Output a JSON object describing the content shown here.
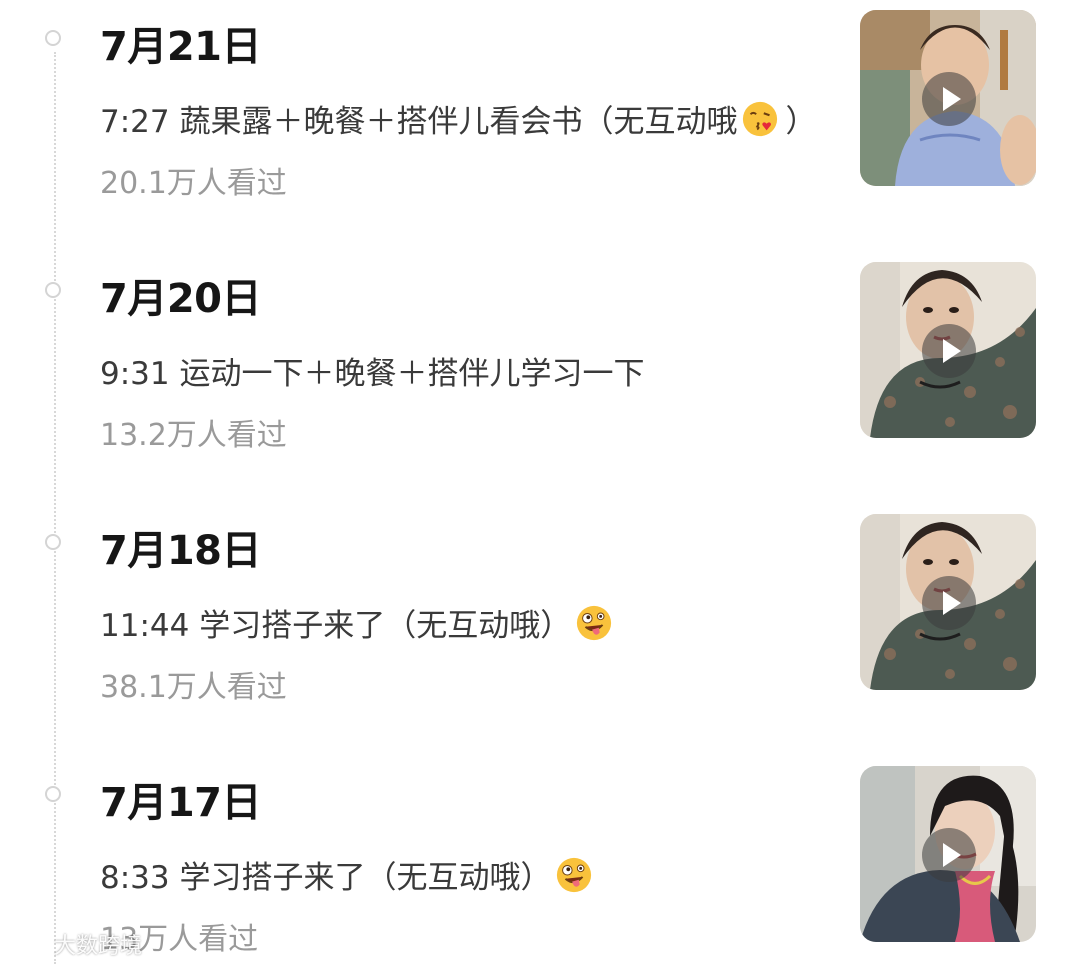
{
  "entries": [
    {
      "date": "7月21日",
      "title_text": "7:27 蔬果露＋晚餐＋搭伴儿看会书（无互动哦",
      "emoji": "kissing-face-icon",
      "title_suffix": "）",
      "views": "20.1万人看过",
      "thumbnail": "video-thumbnail-woman-blue-dress"
    },
    {
      "date": "7月20日",
      "title_text": "9:31 运动一下＋晚餐＋搭伴儿学习一下",
      "emoji": "",
      "title_suffix": "",
      "views": "13.2万人看过",
      "thumbnail": "video-thumbnail-woman-paisley-shirt"
    },
    {
      "date": "7月18日",
      "title_text": "11:44 学习搭子来了（无互动哦）",
      "emoji": "zany-face-icon",
      "title_suffix": "",
      "views": "38.1万人看过",
      "thumbnail": "video-thumbnail-woman-paisley-shirt"
    },
    {
      "date": "7月17日",
      "title_text": "8:33 学习搭子来了（无互动哦）",
      "emoji": "zany-face-icon",
      "title_suffix": "",
      "views": "13万人看过",
      "thumbnail": "video-thumbnail-woman-dark-cardigan"
    }
  ],
  "watermark": {
    "text": "大数跨境",
    "logo": "watermark-logo-icon"
  },
  "colors": {
    "date": "#161616",
    "title": "#3a3a3a",
    "views": "#9a9a9a",
    "timeline": "#d4d4d4"
  }
}
